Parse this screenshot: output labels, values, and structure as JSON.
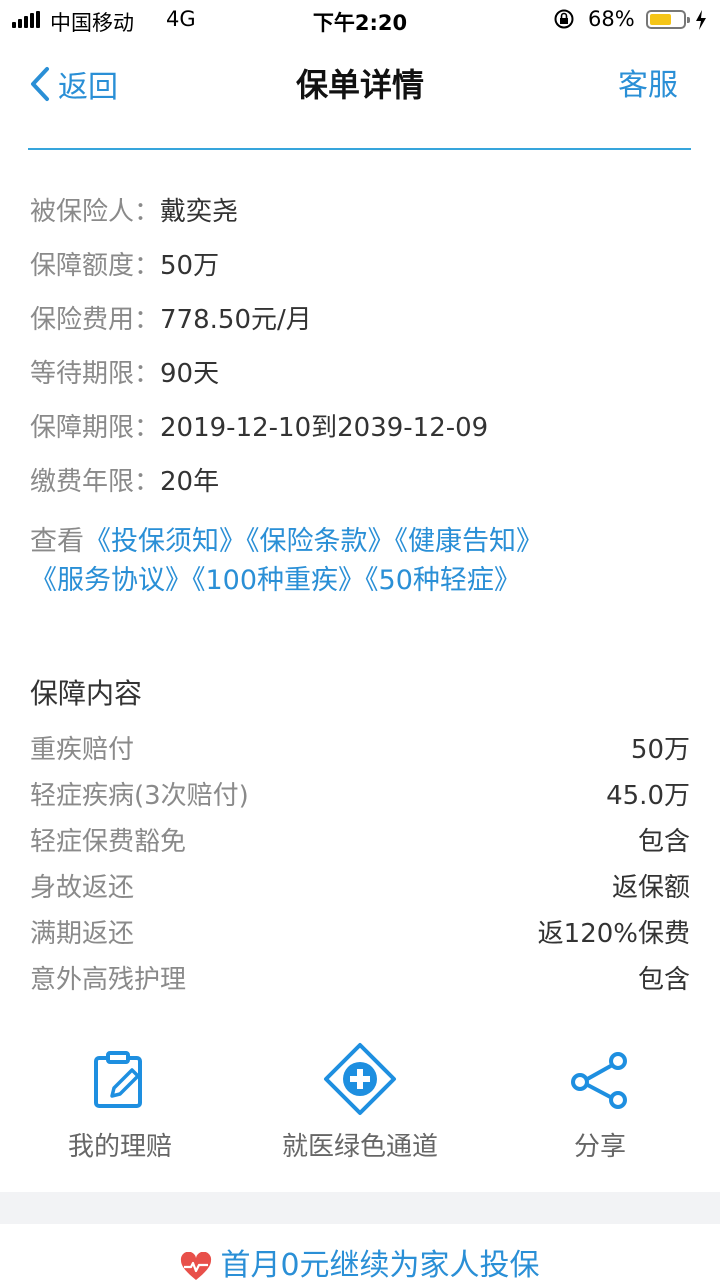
{
  "status_bar": {
    "carrier": "中国移动",
    "network": "4G",
    "time": "下午2:20",
    "battery_percent": "68%",
    "battery_level": 0.68
  },
  "nav": {
    "back_label": "返回",
    "title": "保单详情",
    "service_label": "客服"
  },
  "policy_info": [
    {
      "label": "被保险人：",
      "value": "戴奕尧"
    },
    {
      "label": "保障额度：",
      "value": "50万"
    },
    {
      "label": "保险费用：",
      "value": "778.50元/月"
    },
    {
      "label": "等待期限：",
      "value": "90天"
    },
    {
      "label": "保障期限：",
      "value": "2019-12-10到2039-12-09"
    },
    {
      "label": "缴费年限：",
      "value": "20年"
    }
  ],
  "documents": {
    "prefix": "查看",
    "links": [
      "《投保须知》",
      "《保险条款》",
      "《健康告知》",
      "《服务协议》",
      "《100种重疾》",
      "《50种轻症》"
    ]
  },
  "coverage": {
    "title": "保障内容",
    "items": [
      {
        "label": "重疾赔付",
        "value": "50万"
      },
      {
        "label": "轻症疾病(3次赔付)",
        "value": "45.0万"
      },
      {
        "label": "轻症保费豁免",
        "value": "包含"
      },
      {
        "label": "身故返还",
        "value": "返保额"
      },
      {
        "label": "满期返还",
        "value": "返120%保费"
      },
      {
        "label": "意外高残护理",
        "value": "包含"
      }
    ]
  },
  "actions": [
    {
      "label": "我的理赔",
      "icon": "claim-form-icon"
    },
    {
      "label": "就医绿色通道",
      "icon": "medical-plus-icon"
    },
    {
      "label": "分享",
      "icon": "share-icon"
    }
  ],
  "promo": {
    "text": "首月0元继续为家人投保",
    "icon": "heart-pulse-icon"
  },
  "colors": {
    "accent": "#2a8fd6",
    "divider": "#36a5dc",
    "battery": "#f5c518"
  }
}
